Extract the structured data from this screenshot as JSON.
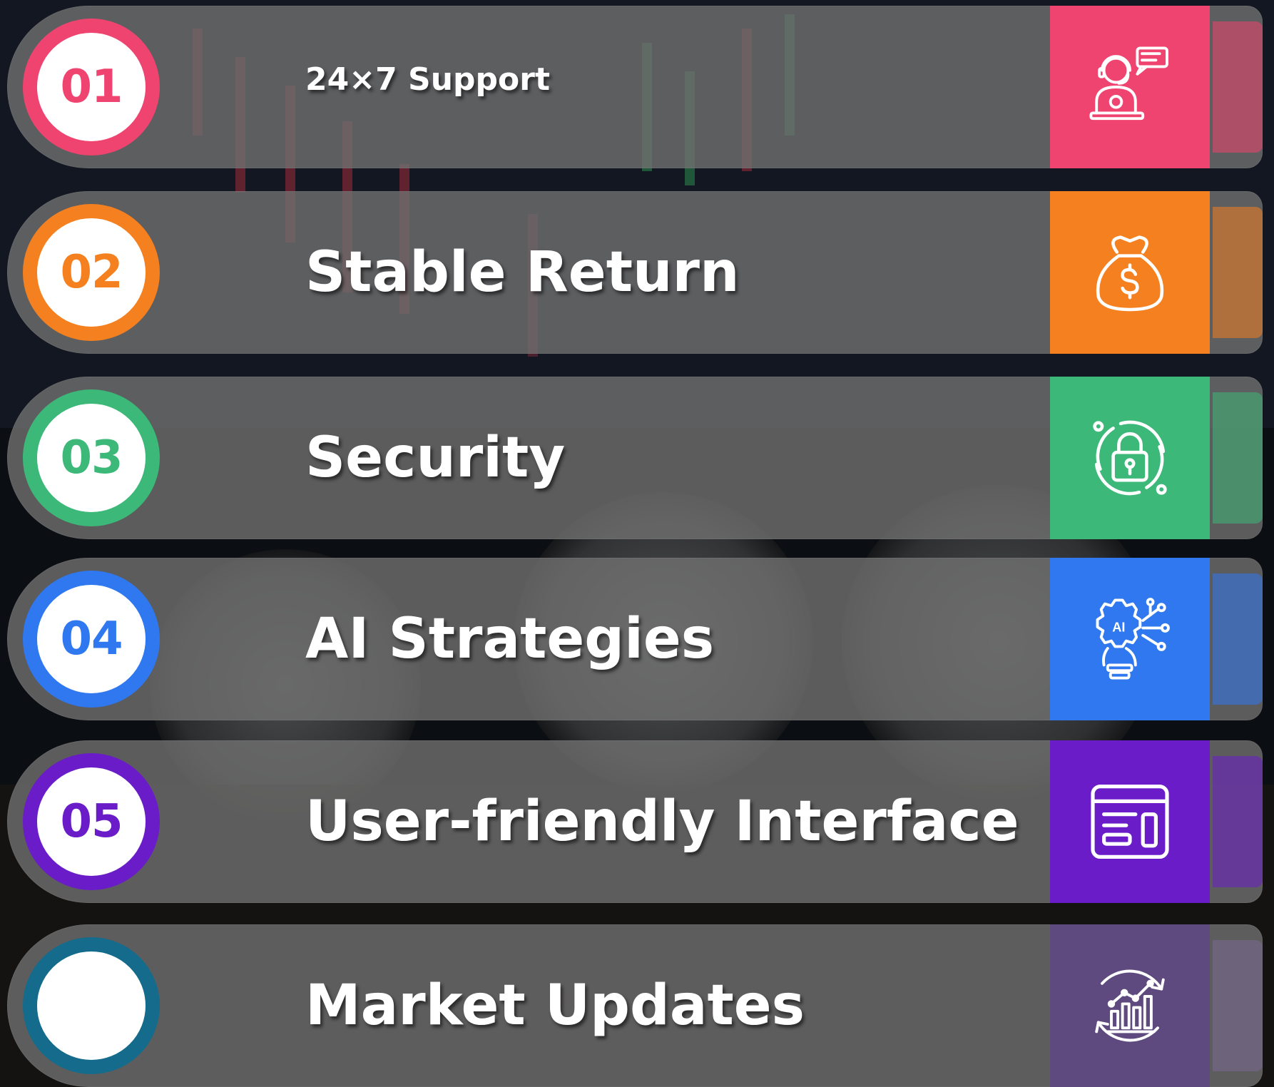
{
  "items": [
    {
      "number": "01",
      "label": "24×7 Support",
      "color": "#f04470",
      "icon": "support-agent-icon"
    },
    {
      "number": "02",
      "label": "Stable Return",
      "color": "#f48020",
      "icon": "money-bag-icon"
    },
    {
      "number": "03",
      "label": "Security",
      "color": "#3cb878",
      "icon": "padlock-icon"
    },
    {
      "number": "04",
      "label": "AI Strategies",
      "color": "#2f78f0",
      "icon": "ai-lightbulb-icon"
    },
    {
      "number": "05",
      "label": "User-friendly Interface",
      "color": "#6a1cc8",
      "icon": "interface-window-icon"
    },
    {
      "number": "",
      "label": "Market Updates",
      "color": "#5e4a7e",
      "badge_color": "#146b8c",
      "icon": "market-chart-icon"
    }
  ]
}
